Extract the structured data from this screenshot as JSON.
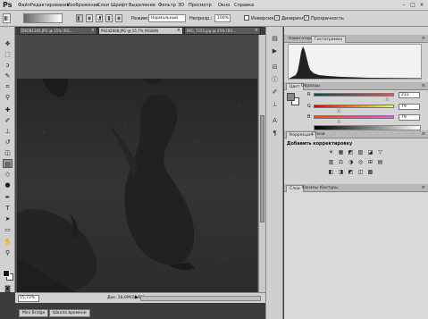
{
  "app": {
    "logo": "Ps",
    "menu": [
      "Файл",
      "Редактирование",
      "Изображение",
      "Слои",
      "Шрифт",
      "Выделение",
      "Фильтр",
      "3D",
      "Просмотр",
      "Окно",
      "Справка"
    ],
    "window_controls": [
      "–",
      "□",
      "×"
    ]
  },
  "options": {
    "mode_label": "Режим:",
    "mode_value": "Нормальный",
    "opacity_label": "Непрозр.:",
    "opacity_value": "100%",
    "inverse_label": "Инверсия",
    "dither_label": "Дизеринг",
    "transparency_label": "Прозрачность",
    "inverse_checked": "",
    "dither_checked": "✓",
    "transparency_checked": "✓"
  },
  "tabs": [
    {
      "label": "DSCN1305.JPG @ 25% (RG...",
      "close": "×"
    },
    {
      "label": "P4242608.JPG @ 15,7% (RGB/8)",
      "close": "×"
    },
    {
      "label": "IMG_7255.jpg @ 25% (RG...",
      "close": "×"
    }
  ],
  "status": {
    "zoom": "15,72%",
    "doc_info": "Док: 28,6M/28,6M",
    "arrow": "▶"
  },
  "bottom_tabs": [
    "Mini Bridge",
    "Шкала времени"
  ],
  "panels": {
    "top_tabs": [
      "Навигатор",
      "Гистограмма"
    ],
    "warning": "▲",
    "color_tabs": [
      "Цвет",
      "Образцы"
    ],
    "channels": [
      {
        "label": "R",
        "value": "231",
        "level": 0.91
      },
      {
        "label": "G",
        "value": "79",
        "level": 0.31
      },
      {
        "label": "B",
        "value": "79",
        "level": 0.31
      }
    ],
    "adj_tabs": [
      "Коррекция",
      "Стили"
    ],
    "adj_title": "Добавить корректировку",
    "adj_icons": [
      "☀",
      "▦",
      "◩",
      "▨",
      "◪",
      "▽",
      "▥",
      "⚖",
      "◑",
      "◎",
      "⊞",
      "▤",
      "◧",
      "◨",
      "◩",
      "◫",
      "▩"
    ],
    "layer_tabs": [
      "Слои",
      "Каналы",
      "Контуры"
    ]
  },
  "colors": {
    "r_track": "linear-gradient(90deg,#004f4f,#ff4f4f)",
    "g_track": "linear-gradient(90deg,#e70000,#e7ff4f)",
    "b_track": "linear-gradient(90deg,#e74f00,#e74fff)"
  }
}
